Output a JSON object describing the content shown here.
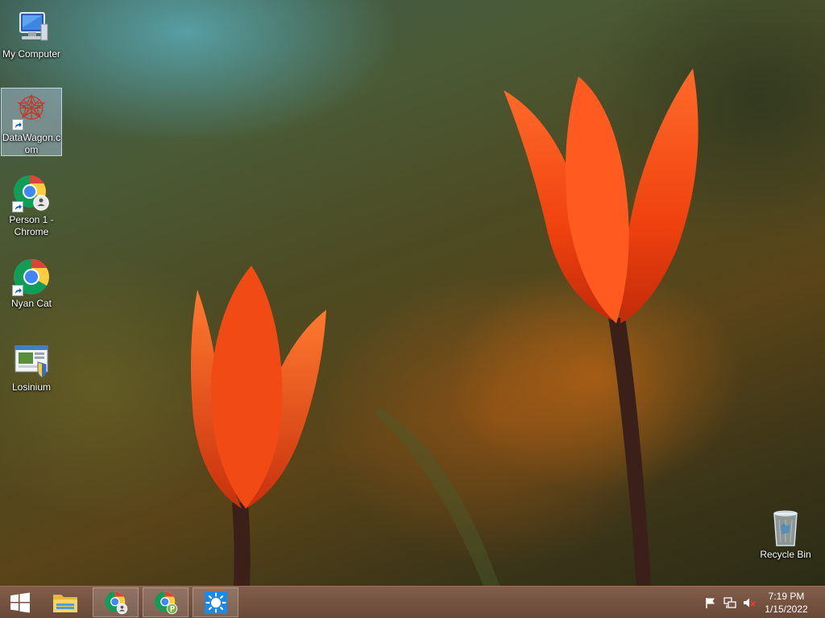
{
  "desktop": {
    "icons": [
      {
        "label": "My Computer",
        "icon": "computer-icon"
      },
      {
        "label": "DataWagon.com",
        "icon": "datawagon-logo-icon",
        "selected": true,
        "shortcut": true
      },
      {
        "label": "Person 1 - Chrome",
        "icon": "chrome-person-icon",
        "shortcut": true
      },
      {
        "label": "Nyan Cat",
        "icon": "chrome-icon",
        "shortcut": true
      },
      {
        "label": "Losinium",
        "icon": "losinium-app-icon"
      }
    ],
    "recycle_bin": {
      "label": "Recycle Bin",
      "icon": "recycle-bin-icon"
    }
  },
  "taskbar": {
    "start": {
      "icon": "windows-logo-icon"
    },
    "pinned": [
      {
        "name": "file-explorer",
        "icon": "folder-icon"
      },
      {
        "name": "chrome-person",
        "icon": "chrome-person-icon",
        "open": true
      },
      {
        "name": "chrome-profile-p",
        "icon": "chrome-p-icon",
        "open": true
      },
      {
        "name": "app-sun",
        "icon": "sun-icon",
        "open": true
      }
    ],
    "tray": [
      {
        "name": "action-center",
        "icon": "flag-icon"
      },
      {
        "name": "network",
        "icon": "network-icon"
      },
      {
        "name": "volume",
        "icon": "volume-muted-icon"
      }
    ],
    "clock": {
      "time": "7:19 PM",
      "date": "1/15/2022"
    }
  }
}
